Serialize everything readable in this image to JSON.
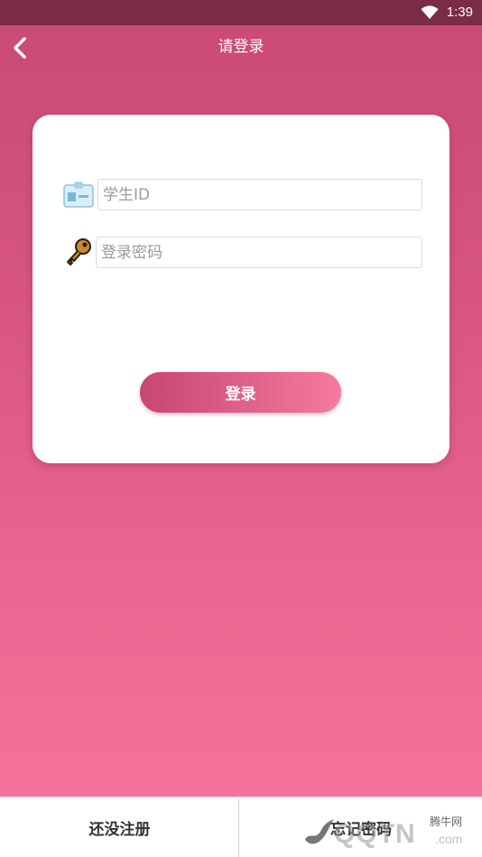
{
  "status_bar": {
    "time": "1:39",
    "wifi_icon": "wifi-icon"
  },
  "nav": {
    "title": "请登录",
    "back_icon": "chevron-left-icon"
  },
  "form": {
    "student_id": {
      "icon": "id-card-icon",
      "placeholder": "学生ID",
      "value": ""
    },
    "password": {
      "icon": "key-icon",
      "placeholder": "登录密码",
      "value": ""
    },
    "login_label": "登录"
  },
  "bottom": {
    "register_label": "还没注册",
    "forgot_label": "忘记密码"
  },
  "watermark": {
    "brand_small": "腾牛网",
    "brand_big": "QQTN",
    "brand_com": ".com"
  },
  "colors": {
    "status_bar": "#7a2c45",
    "gradient_top": "#c94a73",
    "gradient_bottom": "#f5739a",
    "button_start": "#c84672",
    "button_end": "#f57a9e"
  }
}
